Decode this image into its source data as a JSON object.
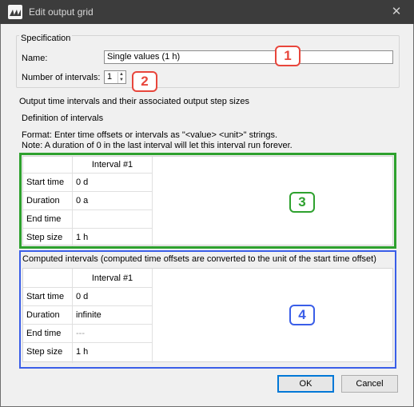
{
  "window": {
    "title": "Edit output grid",
    "close_glyph": "✕",
    "app_icon": "app-logo-icon"
  },
  "specification": {
    "label": "Specification",
    "name_label": "Name:",
    "name_value": "Single values (1 h)",
    "intervals_label": "Number of intervals:",
    "intervals_value": "1"
  },
  "output_section": {
    "label": "Output time intervals and their associated output step sizes",
    "definition_label": "Definition of intervals",
    "format_note": "Format: Enter time offsets or intervals as \"<value> <unit>\" strings.",
    "duration_note": "Note: A duration of 0 in the last interval will let this interval run forever."
  },
  "definition_table": {
    "column_header": "Interval #1",
    "rows": [
      {
        "label": "Start time",
        "value": "0 d"
      },
      {
        "label": "Duration",
        "value": "0 a"
      },
      {
        "label": "End time",
        "value": ""
      },
      {
        "label": "Step size",
        "value": "1 h"
      }
    ]
  },
  "computed_section": {
    "label": "Computed intervals (computed time offsets are converted to the unit of the start time offset)",
    "column_header": "Interval #1",
    "rows": [
      {
        "label": "Start time",
        "value": "0 d"
      },
      {
        "label": "Duration",
        "value": "infinite"
      },
      {
        "label": "End time",
        "value": "---"
      },
      {
        "label": "Step size",
        "value": "1 h"
      }
    ]
  },
  "annotations": {
    "b1": "1",
    "b2": "2",
    "b3": "3",
    "b4": "4"
  },
  "buttons": {
    "ok": "OK",
    "cancel": "Cancel"
  },
  "colors": {
    "title_bar": "#3c3c3c",
    "badge_red": "#e8463c",
    "badge_green": "#2ea12e",
    "badge_blue": "#3a5ee8"
  }
}
